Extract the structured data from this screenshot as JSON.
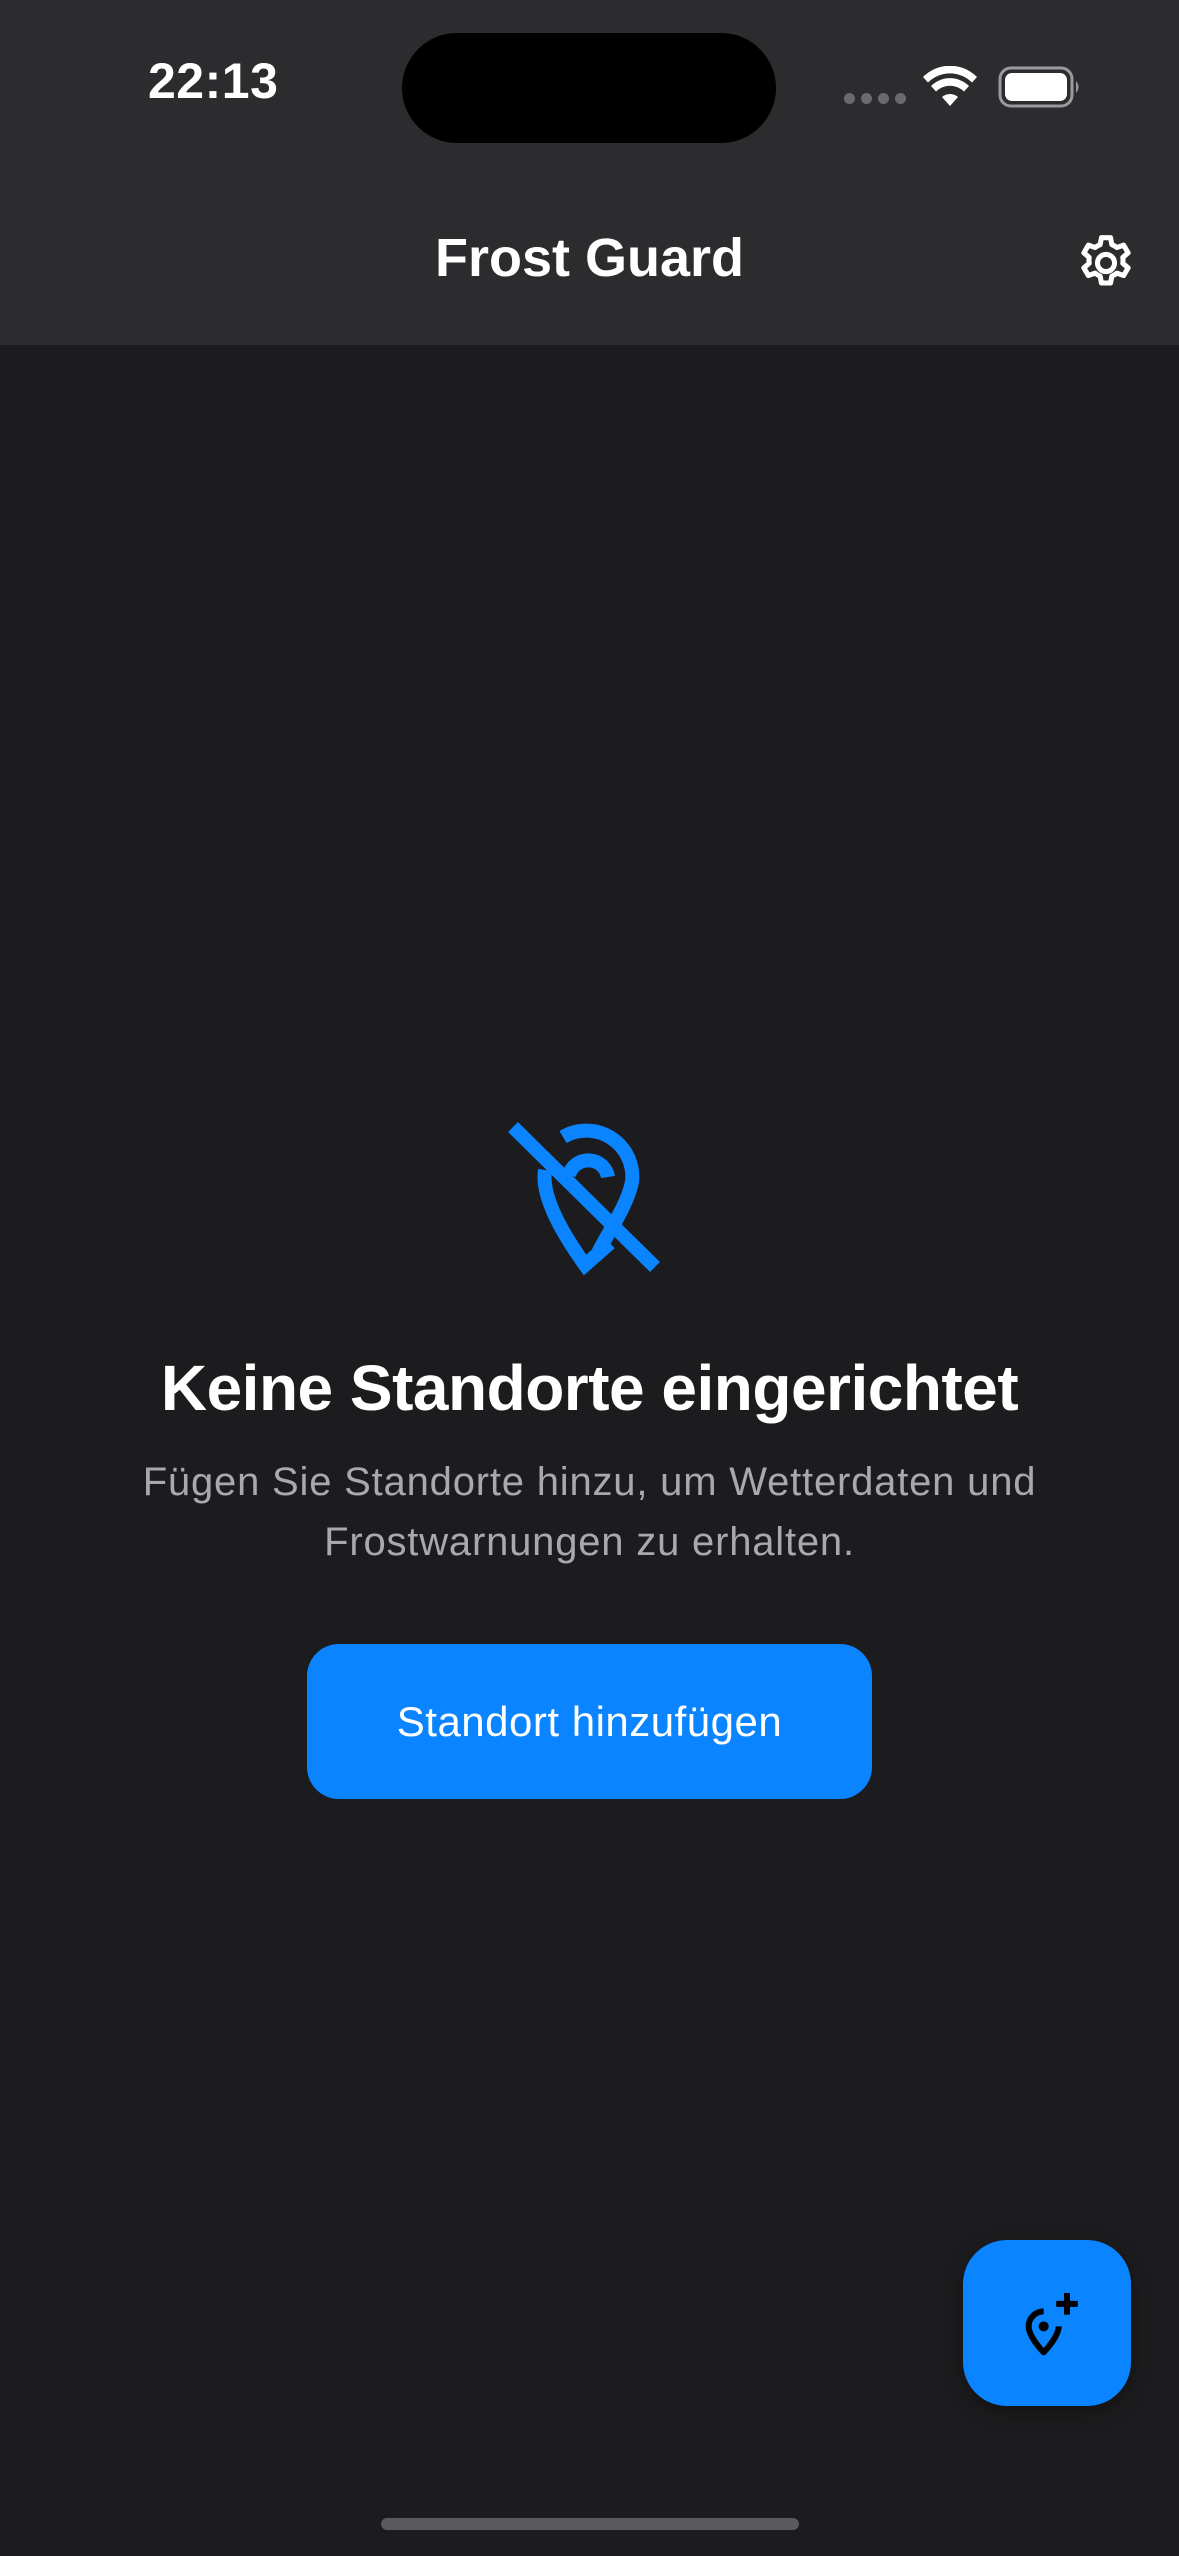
{
  "status_bar": {
    "time": "22:13"
  },
  "nav": {
    "title": "Frost Guard",
    "settings_icon": "gear-icon"
  },
  "empty_state": {
    "icon": "location-off-icon",
    "title": "Keine Standorte eingerichtet",
    "subtitle": "Fügen Sie Standorte hinzu, um Wetterdaten und Frostwarnungen zu erhalten.",
    "button_label": "Standort hinzufügen"
  },
  "fab": {
    "icon": "add-location-icon"
  },
  "colors": {
    "accent": "#0a84ff",
    "background": "#1c1c1e",
    "header": "#2c2c2e",
    "secondary_text": "#a8a8ad"
  }
}
